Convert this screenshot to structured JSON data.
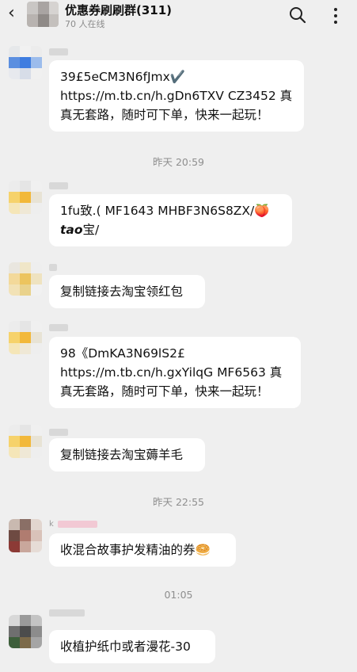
{
  "header": {
    "back_icon": "‹",
    "title": "优惠券刷刷群(311)",
    "subtitle": "70 人在线"
  },
  "messages": [
    {
      "text": "39£5eCM3N6fJmx✔️ https://m.tb.cn/h.gDn6TXV  CZ3452 真真无套路，随时可下单，快来一起玩！"
    },
    {
      "text_a": "1fu致.( MF1643 MHBF3N6S8ZX/🍑",
      "text_b_i": "tao",
      "text_b": "宝/"
    },
    {
      "text": "复制链接去淘宝领红包"
    },
    {
      "text": "98《DmKA3N69lS2£ https://m.tb.cn/h.gxYilqG  MF6563 真真无套路，随时可下单，快来一起玩！"
    },
    {
      "text": "复制链接去淘宝薅羊毛"
    },
    {
      "text": "收混合故事护发精油的券🥯"
    },
    {
      "text": "收植护纸巾或者漫花-30"
    }
  ],
  "timestamps": [
    "昨天 20:59",
    "昨天 22:55",
    "01:05"
  ],
  "sender_prefix": "k"
}
